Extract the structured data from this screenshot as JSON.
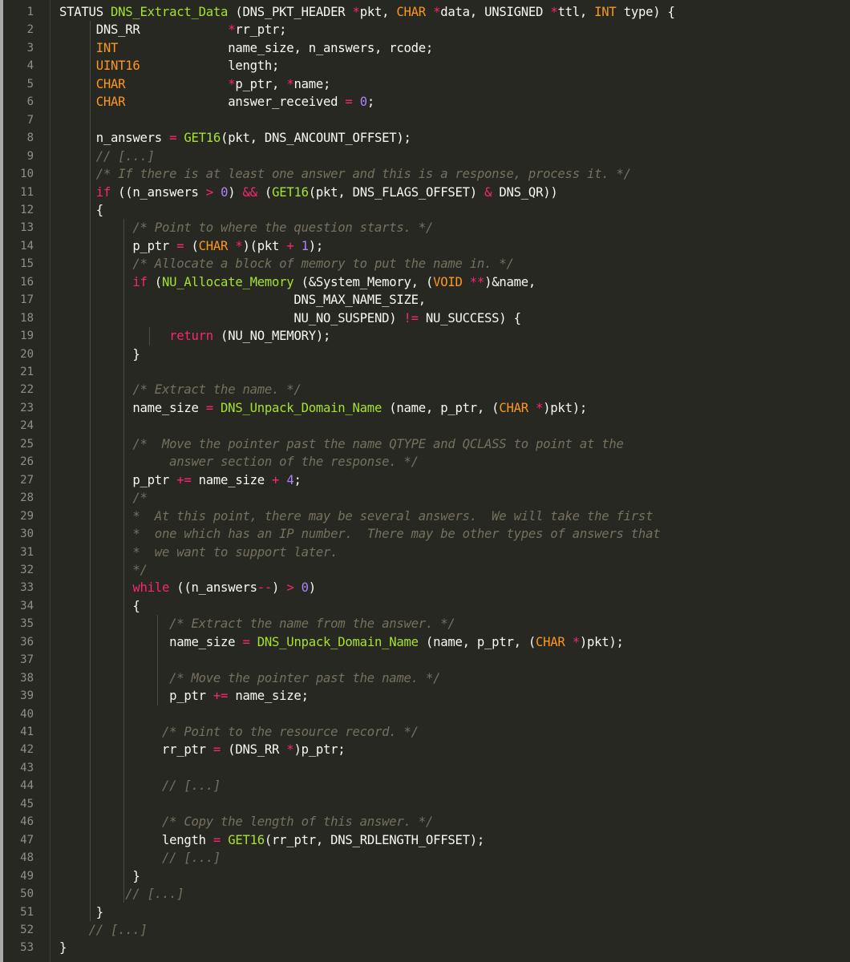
{
  "editor": {
    "theme": {
      "background": "#272822",
      "text": "#f8f8f2",
      "keyword": "#f92672",
      "type": "#fd971f",
      "function": "#a6e22e",
      "number": "#ae81ff",
      "comment": "#75715e",
      "gutter_text": "#8f908a"
    },
    "lines": [
      {
        "n": "1",
        "t": [
          [
            "tx",
            "STATUS "
          ],
          [
            "fn",
            "DNS_Extract_Data"
          ],
          [
            "tx",
            " (DNS_PKT_HEADER "
          ],
          [
            "op",
            "*"
          ],
          [
            "tx",
            "pkt, "
          ],
          [
            "type",
            "CHAR"
          ],
          [
            "tx",
            " "
          ],
          [
            "op",
            "*"
          ],
          [
            "tx",
            "data, UNSIGNED "
          ],
          [
            "op",
            "*"
          ],
          [
            "tx",
            "ttl, "
          ],
          [
            "type",
            "INT"
          ],
          [
            "tx",
            " type) {"
          ]
        ]
      },
      {
        "n": "2",
        "t": [
          [
            "tx",
            "     DNS_RR            "
          ],
          [
            "op",
            "*"
          ],
          [
            "tx",
            "rr_ptr;"
          ]
        ]
      },
      {
        "n": "3",
        "t": [
          [
            "tx",
            "     "
          ],
          [
            "type",
            "INT"
          ],
          [
            "tx",
            "               name_size, n_answers, rcode;"
          ]
        ]
      },
      {
        "n": "4",
        "t": [
          [
            "tx",
            "     "
          ],
          [
            "type",
            "UINT16"
          ],
          [
            "tx",
            "            length;"
          ]
        ]
      },
      {
        "n": "5",
        "t": [
          [
            "tx",
            "     "
          ],
          [
            "type",
            "CHAR"
          ],
          [
            "tx",
            "              "
          ],
          [
            "op",
            "*"
          ],
          [
            "tx",
            "p_ptr, "
          ],
          [
            "op",
            "*"
          ],
          [
            "tx",
            "name;"
          ]
        ]
      },
      {
        "n": "6",
        "t": [
          [
            "tx",
            "     "
          ],
          [
            "type",
            "CHAR"
          ],
          [
            "tx",
            "              answer_received "
          ],
          [
            "op",
            "="
          ],
          [
            "tx",
            " "
          ],
          [
            "num",
            "0"
          ],
          [
            "tx",
            ";"
          ]
        ]
      },
      {
        "n": "7",
        "t": []
      },
      {
        "n": "8",
        "t": [
          [
            "tx",
            "     n_answers "
          ],
          [
            "op",
            "="
          ],
          [
            "tx",
            " "
          ],
          [
            "fn",
            "GET16"
          ],
          [
            "tx",
            "(pkt, DNS_ANCOUNT_OFFSET);"
          ]
        ]
      },
      {
        "n": "9",
        "t": [
          [
            "tx",
            "     "
          ],
          [
            "cm",
            "// [...]"
          ]
        ]
      },
      {
        "n": "10",
        "t": [
          [
            "tx",
            "     "
          ],
          [
            "cm",
            "/* If there is at least one answer and this is a response, process it. */"
          ]
        ]
      },
      {
        "n": "11",
        "t": [
          [
            "tx",
            "     "
          ],
          [
            "kw",
            "if"
          ],
          [
            "tx",
            " ((n_answers "
          ],
          [
            "op",
            ">"
          ],
          [
            "tx",
            " "
          ],
          [
            "num",
            "0"
          ],
          [
            "tx",
            ") "
          ],
          [
            "op",
            "&&"
          ],
          [
            "tx",
            " ("
          ],
          [
            "fn",
            "GET16"
          ],
          [
            "tx",
            "(pkt, DNS_FLAGS_OFFSET) "
          ],
          [
            "op",
            "&"
          ],
          [
            "tx",
            " DNS_QR))"
          ]
        ]
      },
      {
        "n": "12",
        "t": [
          [
            "tx",
            "     {"
          ]
        ]
      },
      {
        "n": "13",
        "t": [
          [
            "tx",
            "          "
          ],
          [
            "cm",
            "/* Point to where the question starts. */"
          ]
        ]
      },
      {
        "n": "14",
        "t": [
          [
            "tx",
            "          p_ptr "
          ],
          [
            "op",
            "="
          ],
          [
            "tx",
            " ("
          ],
          [
            "type",
            "CHAR"
          ],
          [
            "tx",
            " "
          ],
          [
            "op",
            "*"
          ],
          [
            "tx",
            ")(pkt "
          ],
          [
            "op",
            "+"
          ],
          [
            "tx",
            " "
          ],
          [
            "num",
            "1"
          ],
          [
            "tx",
            ");"
          ]
        ]
      },
      {
        "n": "15",
        "t": [
          [
            "tx",
            "          "
          ],
          [
            "cm",
            "/* Allocate a block of memory to put the name in. */"
          ]
        ]
      },
      {
        "n": "16",
        "t": [
          [
            "tx",
            "          "
          ],
          [
            "kw",
            "if"
          ],
          [
            "tx",
            " ("
          ],
          [
            "fn",
            "NU_Allocate_Memory"
          ],
          [
            "tx",
            " (&System_Memory, ("
          ],
          [
            "type",
            "VOID"
          ],
          [
            "tx",
            " "
          ],
          [
            "op",
            "**"
          ],
          [
            "tx",
            ")&name,"
          ]
        ]
      },
      {
        "n": "17",
        "t": [
          [
            "tx",
            "                                DNS_MAX_NAME_SIZE,"
          ]
        ]
      },
      {
        "n": "18",
        "t": [
          [
            "tx",
            "                                NU_NO_SUSPEND) "
          ],
          [
            "op",
            "!="
          ],
          [
            "tx",
            " NU_SUCCESS) {"
          ]
        ]
      },
      {
        "n": "19",
        "t": [
          [
            "tx",
            "               "
          ],
          [
            "kw",
            "return"
          ],
          [
            "tx",
            " (NU_NO_MEMORY);"
          ]
        ]
      },
      {
        "n": "20",
        "t": [
          [
            "tx",
            "          }"
          ]
        ]
      },
      {
        "n": "21",
        "t": []
      },
      {
        "n": "22",
        "t": [
          [
            "tx",
            "          "
          ],
          [
            "cm",
            "/* Extract the name. */"
          ]
        ]
      },
      {
        "n": "23",
        "t": [
          [
            "tx",
            "          name_size "
          ],
          [
            "op",
            "="
          ],
          [
            "tx",
            " "
          ],
          [
            "fn",
            "DNS_Unpack_Domain_Name"
          ],
          [
            "tx",
            " (name, p_ptr, ("
          ],
          [
            "type",
            "CHAR"
          ],
          [
            "tx",
            " "
          ],
          [
            "op",
            "*"
          ],
          [
            "tx",
            ")pkt);"
          ]
        ]
      },
      {
        "n": "24",
        "t": []
      },
      {
        "n": "25",
        "t": [
          [
            "tx",
            "          "
          ],
          [
            "cm",
            "/*  Move the pointer past the name QTYPE and QCLASS to point at the"
          ]
        ]
      },
      {
        "n": "26",
        "t": [
          [
            "tx",
            "               "
          ],
          [
            "cm",
            "answer section of the response. */"
          ]
        ]
      },
      {
        "n": "27",
        "t": [
          [
            "tx",
            "          p_ptr "
          ],
          [
            "op",
            "+="
          ],
          [
            "tx",
            " name_size "
          ],
          [
            "op",
            "+"
          ],
          [
            "tx",
            " "
          ],
          [
            "num",
            "4"
          ],
          [
            "tx",
            ";"
          ]
        ]
      },
      {
        "n": "28",
        "t": [
          [
            "tx",
            "          "
          ],
          [
            "cm",
            "/*"
          ]
        ]
      },
      {
        "n": "29",
        "t": [
          [
            "tx",
            "          "
          ],
          [
            "cm",
            "*  At this point, there may be several answers.  We will take the first"
          ]
        ]
      },
      {
        "n": "30",
        "t": [
          [
            "tx",
            "          "
          ],
          [
            "cm",
            "*  one which has an IP number.  There may be other types of answers that"
          ]
        ]
      },
      {
        "n": "31",
        "t": [
          [
            "tx",
            "          "
          ],
          [
            "cm",
            "*  we want to support later."
          ]
        ]
      },
      {
        "n": "32",
        "t": [
          [
            "tx",
            "          "
          ],
          [
            "cm",
            "*/"
          ]
        ]
      },
      {
        "n": "33",
        "t": [
          [
            "tx",
            "          "
          ],
          [
            "kw",
            "while"
          ],
          [
            "tx",
            " ((n_answers"
          ],
          [
            "op",
            "--"
          ],
          [
            "tx",
            ") "
          ],
          [
            "op",
            ">"
          ],
          [
            "tx",
            " "
          ],
          [
            "num",
            "0"
          ],
          [
            "tx",
            ")"
          ]
        ]
      },
      {
        "n": "34",
        "t": [
          [
            "tx",
            "          {"
          ]
        ]
      },
      {
        "n": "35",
        "t": [
          [
            "tx",
            "               "
          ],
          [
            "cm",
            "/* Extract the name from the answer. */"
          ]
        ]
      },
      {
        "n": "36",
        "t": [
          [
            "tx",
            "               name_size "
          ],
          [
            "op",
            "="
          ],
          [
            "tx",
            " "
          ],
          [
            "fn",
            "DNS_Unpack_Domain_Name"
          ],
          [
            "tx",
            " (name, p_ptr, ("
          ],
          [
            "type",
            "CHAR"
          ],
          [
            "tx",
            " "
          ],
          [
            "op",
            "*"
          ],
          [
            "tx",
            ")pkt);"
          ]
        ]
      },
      {
        "n": "37",
        "t": []
      },
      {
        "n": "38",
        "t": [
          [
            "tx",
            "               "
          ],
          [
            "cm",
            "/* Move the pointer past the name. */"
          ]
        ]
      },
      {
        "n": "39",
        "t": [
          [
            "tx",
            "               p_ptr "
          ],
          [
            "op",
            "+="
          ],
          [
            "tx",
            " name_size;"
          ]
        ]
      },
      {
        "n": "40",
        "t": []
      },
      {
        "n": "41",
        "t": [
          [
            "tx",
            "              "
          ],
          [
            "cm",
            "/* Point to the resource record. */"
          ]
        ]
      },
      {
        "n": "42",
        "t": [
          [
            "tx",
            "              rr_ptr "
          ],
          [
            "op",
            "="
          ],
          [
            "tx",
            " (DNS_RR "
          ],
          [
            "op",
            "*"
          ],
          [
            "tx",
            ")p_ptr;"
          ]
        ]
      },
      {
        "n": "43",
        "t": []
      },
      {
        "n": "44",
        "t": [
          [
            "tx",
            "              "
          ],
          [
            "cm",
            "// [...]"
          ]
        ]
      },
      {
        "n": "45",
        "t": []
      },
      {
        "n": "46",
        "t": [
          [
            "tx",
            "              "
          ],
          [
            "cm",
            "/* Copy the length of this answer. */"
          ]
        ]
      },
      {
        "n": "47",
        "t": [
          [
            "tx",
            "              length "
          ],
          [
            "op",
            "="
          ],
          [
            "tx",
            " "
          ],
          [
            "fn",
            "GET16"
          ],
          [
            "tx",
            "(rr_ptr, DNS_RDLENGTH_OFFSET);"
          ]
        ]
      },
      {
        "n": "48",
        "t": [
          [
            "tx",
            "              "
          ],
          [
            "cm",
            "// [...]"
          ]
        ]
      },
      {
        "n": "49",
        "t": [
          [
            "tx",
            "          }"
          ]
        ]
      },
      {
        "n": "50",
        "t": [
          [
            "tx",
            "         "
          ],
          [
            "cm",
            "// [...]"
          ]
        ]
      },
      {
        "n": "51",
        "t": [
          [
            "tx",
            "     }"
          ]
        ]
      },
      {
        "n": "52",
        "t": [
          [
            "tx",
            "    "
          ],
          [
            "cm",
            "// [...]"
          ]
        ]
      },
      {
        "n": "53",
        "t": [
          [
            "tx",
            "}"
          ]
        ]
      }
    ]
  }
}
